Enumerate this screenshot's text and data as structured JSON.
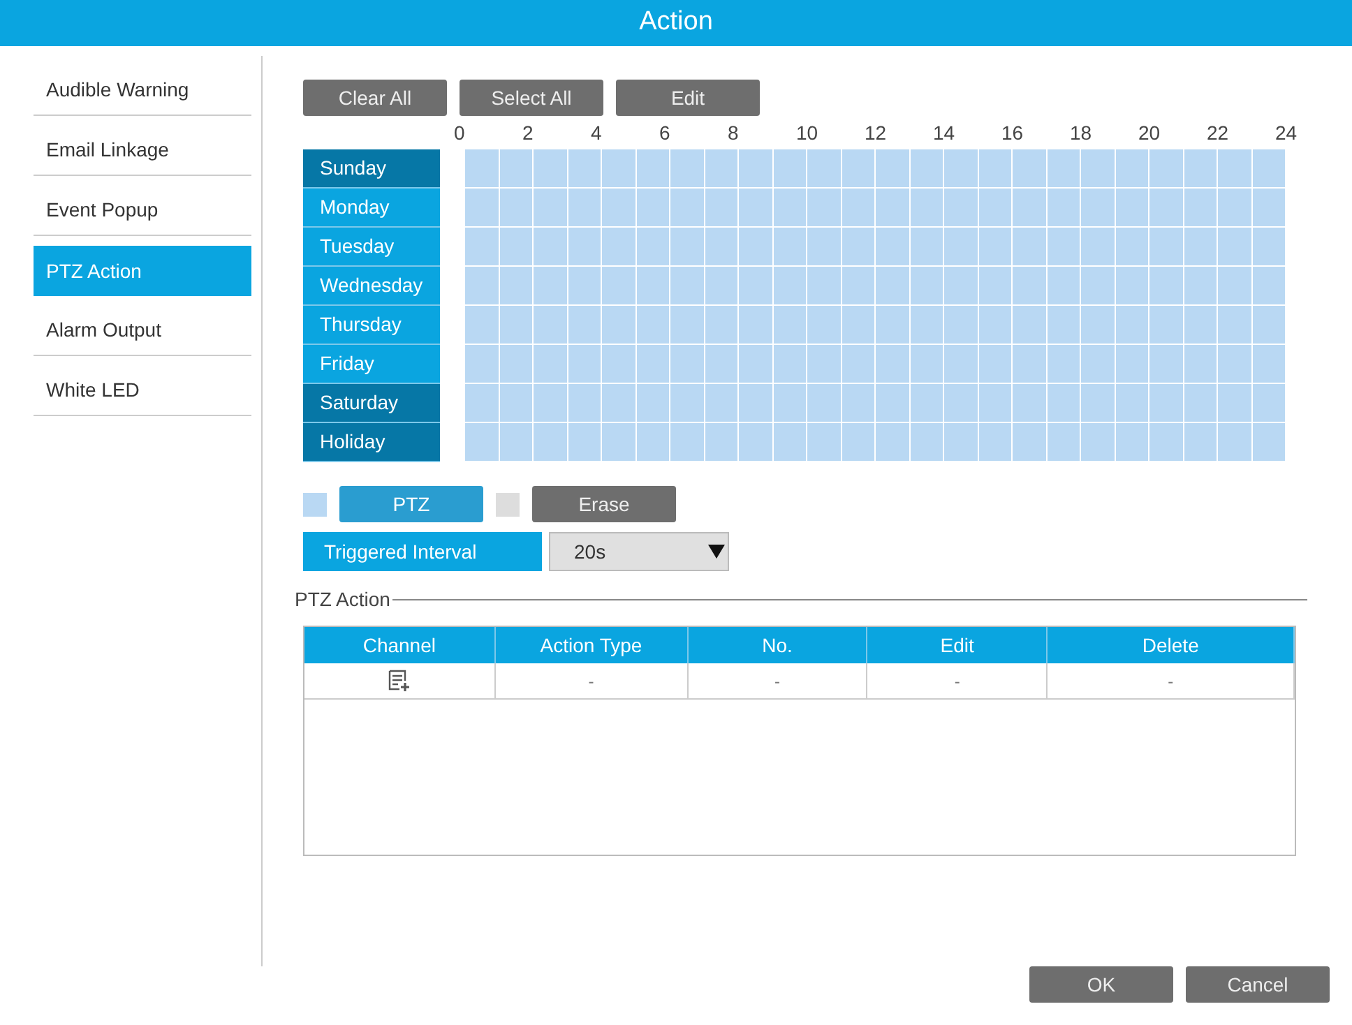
{
  "window": {
    "title": "Action"
  },
  "sidebar": {
    "items": [
      {
        "label": "Audible Warning",
        "selected": false
      },
      {
        "label": "Email Linkage",
        "selected": false
      },
      {
        "label": "Event Popup",
        "selected": false
      },
      {
        "label": "PTZ Action",
        "selected": true
      },
      {
        "label": "Alarm Output",
        "selected": false
      },
      {
        "label": "White LED",
        "selected": false
      }
    ]
  },
  "toolbar": [
    "Clear All",
    "Select All",
    "Edit"
  ],
  "schedule": {
    "hours": [
      "0",
      "2",
      "4",
      "6",
      "8",
      "10",
      "12",
      "14",
      "16",
      "18",
      "20",
      "22",
      "24"
    ],
    "days": [
      {
        "label": "Sunday",
        "highlighted": true,
        "filled": true
      },
      {
        "label": "Monday",
        "highlighted": false,
        "filled": true
      },
      {
        "label": "Tuesday",
        "highlighted": false,
        "filled": true
      },
      {
        "label": "Wednesday",
        "highlighted": false,
        "filled": true
      },
      {
        "label": "Thursday",
        "highlighted": false,
        "filled": true
      },
      {
        "label": "Friday",
        "highlighted": false,
        "filled": true
      },
      {
        "label": "Saturday",
        "highlighted": true,
        "filled": true
      },
      {
        "label": "Holiday",
        "highlighted": true,
        "filled": true
      }
    ]
  },
  "modes": [
    {
      "label": "PTZ",
      "selected": true,
      "color": "#b9d8f3"
    },
    {
      "label": "Erase",
      "selected": false,
      "color": "#dddddd"
    }
  ],
  "triggered_interval": {
    "label": "Triggered Interval",
    "value": "20s"
  },
  "ptz_action": {
    "title": "PTZ Action",
    "columns": [
      "Channel",
      "Action Type",
      "No.",
      "Edit",
      "Delete"
    ],
    "rows": [
      {
        "cells": [
          {
            "kind": "add"
          },
          {
            "kind": "text",
            "text": "-"
          },
          {
            "kind": "text",
            "text": "-"
          },
          {
            "kind": "text",
            "text": "-"
          },
          {
            "kind": "text",
            "text": "-"
          }
        ]
      }
    ]
  },
  "buttons": [
    "OK",
    "Cancel"
  ]
}
